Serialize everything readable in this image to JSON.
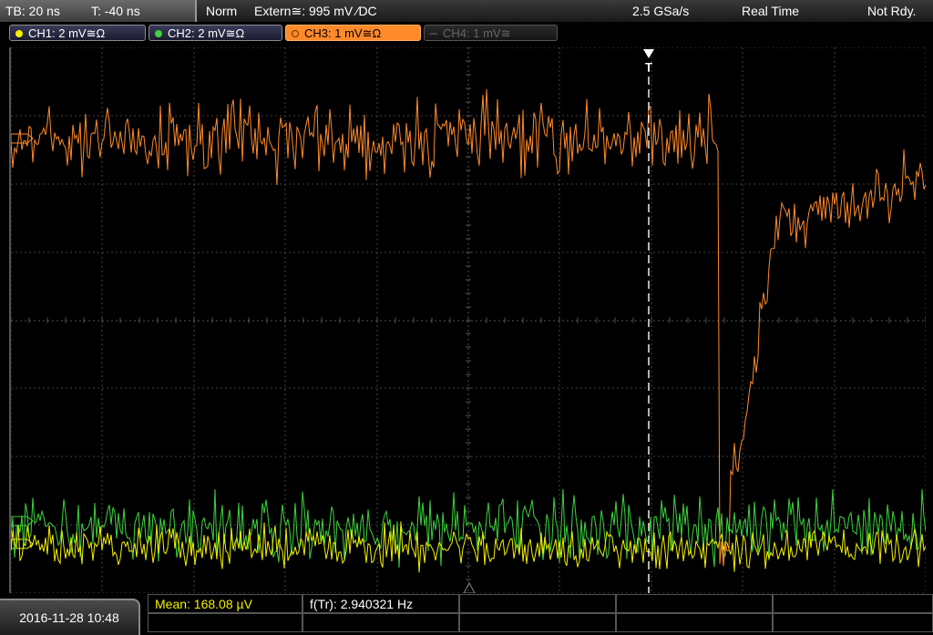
{
  "status_bar": {
    "timebase": "TB: 20 ns",
    "trigger_time": "T: -40 ns",
    "trigger_mode": "Norm",
    "trigger_source": "Extern≅: 995 mV ∕DC",
    "sample_rate": "2.5 GSa/s",
    "acq_mode": "Real Time",
    "ready_state": "Not Rdy."
  },
  "channels": [
    {
      "label": "CH1: 2 mV≅Ω",
      "color": "#f4f000",
      "state": "on"
    },
    {
      "label": "CH2: 2 mV≅Ω",
      "color": "#3cd43c",
      "state": "on"
    },
    {
      "label": "CH3: 1 mV≅Ω",
      "color": "#ff8a2a",
      "state": "selected"
    },
    {
      "label": "CH4: 1 mV≅",
      "color": "#666666",
      "state": "off"
    }
  ],
  "trigger_marker": "T",
  "datetime": "2016-11-28 10:48",
  "measurements": {
    "mean": "Mean: 168.08 µV",
    "freq": "f(Tr): 2.940321 Hz"
  },
  "colors": {
    "ch1": "#f4f000",
    "ch2": "#3cd43c",
    "ch3": "#ff8a2a",
    "grid": "#555555",
    "background": "#000000"
  },
  "waveform_description": {
    "ch3": "noisy baseline with sharp negative dip after trigger then recovery",
    "ch1": "noise near bottom of screen",
    "ch2": "noise near bottom of screen"
  }
}
